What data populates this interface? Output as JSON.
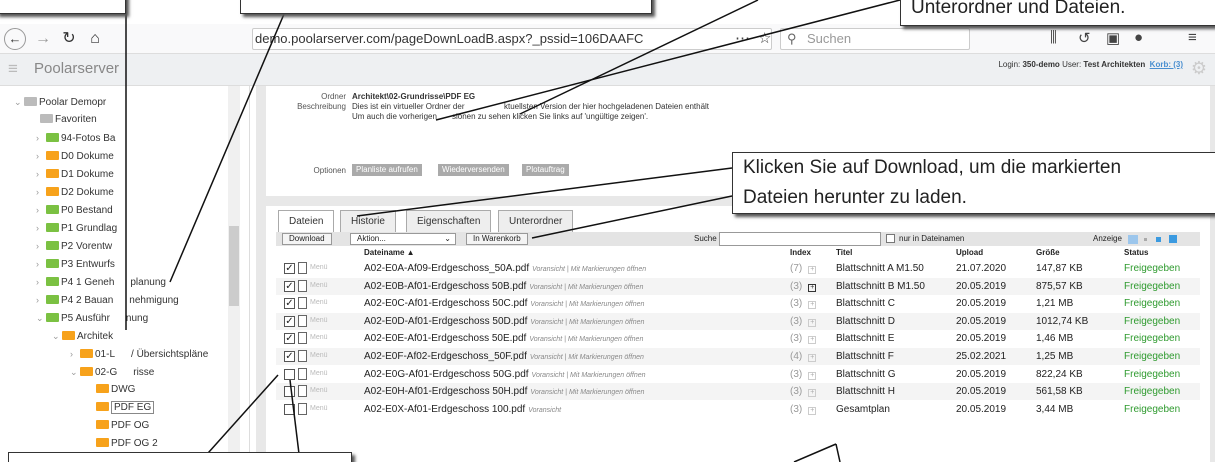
{
  "browser": {
    "url": "demo.poolarserver.com/pageDownLoadB.aspx?_pssid=106DAAFC",
    "search_placeholder": "Suchen"
  },
  "app": {
    "title": "Poolarserver",
    "login_prefix": "Login:",
    "login_user": "350-demo",
    "user_prefix": "User:",
    "user_name": "Test Architekten",
    "korb": "Korb: (3)"
  },
  "tree": [
    {
      "label": "Poolar Demopr",
      "folder": "gray"
    },
    {
      "label": "Favoriten",
      "folder": "gray"
    },
    {
      "label": "94-Fotos Ba",
      "folder": "green"
    },
    {
      "label": "D0 Dokume",
      "folder": "yellow"
    },
    {
      "label": "D1 Dokume",
      "folder": "yellow"
    },
    {
      "label": "D2 Dokume",
      "folder": "yellow"
    },
    {
      "label": "P0 Bestand",
      "folder": "green"
    },
    {
      "label": "P1 Grundlag",
      "folder": "green"
    },
    {
      "label": "P2 Vorentw",
      "folder": "green"
    },
    {
      "label": "P3 Entwurfs",
      "folder": "green"
    },
    {
      "label": "P4 1 Geneh",
      "extra": "planung",
      "folder": "green"
    },
    {
      "label": "P4 2 Bauan",
      "extra": "nehmigung",
      "folder": "green"
    },
    {
      "label": "P5 Ausführ",
      "extra": "nung",
      "folder": "green"
    },
    {
      "label": "Architek",
      "folder": "yellow"
    },
    {
      "label": "01-L",
      "extra": "/ Übersichtspläne",
      "folder": "yellow"
    },
    {
      "label": "02-G",
      "extra": "risse",
      "folder": "yellow"
    },
    {
      "label": "DWG",
      "folder": "yellow"
    },
    {
      "label": "PDF EG",
      "folder": "yellow",
      "selected": true
    },
    {
      "label": "PDF OG",
      "folder": "yellow"
    },
    {
      "label": "PDF OG 2",
      "folder": "yellow"
    }
  ],
  "info": {
    "ordner_label": "Ordner",
    "ordner_value": "Architekt\\02-Grundrisse\\PDF EG",
    "beschreibung_label": "Beschreibung",
    "beschreibung_line1": "Dies ist ein virtueller Ordner der",
    "beschreibung_line1b": "ktuellsten Version der hier hochgeladenen Dateien enthält",
    "beschreibung_line2": "Um auch die vorherigen",
    "beschreibung_line2b": "sionen zu sehen klicken Sie links auf 'ungültige zeigen'.",
    "optionen_label": "Optionen",
    "opt_buttons": [
      "Planliste aufrufen",
      "Wiederversenden",
      "Plotauftrag"
    ]
  },
  "tabs": [
    "Dateien",
    "Historie",
    "Eigenschaften",
    "Unterordner"
  ],
  "toolbar": {
    "download": "Download",
    "aktion": "Aktion...",
    "warenkorb": "In Warenkorb",
    "suche": "Suche",
    "nur_dateinamen": "nur in Dateinamen",
    "anzeige": "Anzeige"
  },
  "columns": {
    "dateiname": "Dateiname ▲",
    "index": "Index",
    "titel": "Titel",
    "upload": "Upload",
    "groesse": "Größe",
    "status": "Status"
  },
  "menu_label": "Menü",
  "rows": [
    {
      "name": "A02-E0A-Af09-Erdgeschoss_50A.pdf",
      "preview": "Voransicht | Mit Markierungen öffnen",
      "index": "(7)",
      "titel": "Blattschnitt A M1.50",
      "upload": "21.07.2020",
      "size": "147,87 KB",
      "status": "Freigegeben",
      "checked": true
    },
    {
      "name": "A02-E0B-Af01-Erdgeschoss 50B.pdf",
      "preview": "Voransicht | Mit Markierungen öffnen",
      "index": "(3)",
      "titel": "Blattschnitt B M1.50",
      "upload": "20.05.2019",
      "size": "875,57 KB",
      "status": "Freigegeben",
      "checked": true
    },
    {
      "name": "A02-E0C-Af01-Erdgeschoss 50C.pdf",
      "preview": "Voransicht | Mit Markierungen öffnen",
      "index": "(3)",
      "titel": "Blattschnitt C",
      "upload": "20.05.2019",
      "size": "1,21 MB",
      "status": "Freigegeben",
      "checked": true
    },
    {
      "name": "A02-E0D-Af01-Erdgeschoss 50D.pdf",
      "preview": "Voransicht | Mit Markierungen öffnen",
      "index": "(3)",
      "titel": "Blattschnitt D",
      "upload": "20.05.2019",
      "size": "1012,74 KB",
      "status": "Freigegeben",
      "checked": true
    },
    {
      "name": "A02-E0E-Af01-Erdgeschoss 50E.pdf",
      "preview": "Voransicht | Mit Markierungen öffnen",
      "index": "(3)",
      "titel": "Blattschnitt E",
      "upload": "20.05.2019",
      "size": "1,46 MB",
      "status": "Freigegeben",
      "checked": true
    },
    {
      "name": "A02-E0F-Af02-Erdgeschoss_50F.pdf",
      "preview": "Voransicht | Mit Markierungen öffnen",
      "index": "(4)",
      "titel": "Blattschnitt F",
      "upload": "25.02.2021",
      "size": "1,25 MB",
      "status": "Freigegeben",
      "checked": true
    },
    {
      "name": "A02-E0G-Af01-Erdgeschoss 50G.pdf",
      "preview": "Voransicht | Mit Markierungen öffnen",
      "index": "(3)",
      "titel": "Blattschnitt G",
      "upload": "20.05.2019",
      "size": "822,24 KB",
      "status": "Freigegeben",
      "checked": false
    },
    {
      "name": "A02-E0H-Af01-Erdgeschoss 50H.pdf",
      "preview": "Voransicht | Mit Markierungen öffnen",
      "index": "(3)",
      "titel": "Blattschnitt H",
      "upload": "20.05.2019",
      "size": "561,58 KB",
      "status": "Freigegeben",
      "checked": false
    },
    {
      "name": "A02-E0X-Af01-Erdgeschoss 100.pdf",
      "preview": "Voransicht",
      "index": "(3)",
      "titel": "Gesamtplan",
      "upload": "20.05.2019",
      "size": "3,44 MB",
      "status": "Freigegeben",
      "checked": false
    }
  ],
  "callouts": {
    "top_right": "Unterordner und Dateien.",
    "download_line1": "Klicken Sie auf Download, um die markierten",
    "download_line2": "Dateien herunter zu laden."
  },
  "colors": {
    "green_folder": "#7bc142",
    "yellow_folder": "#f7a21b",
    "status_ok": "#2e9a2e",
    "link": "#4a8fd0"
  }
}
